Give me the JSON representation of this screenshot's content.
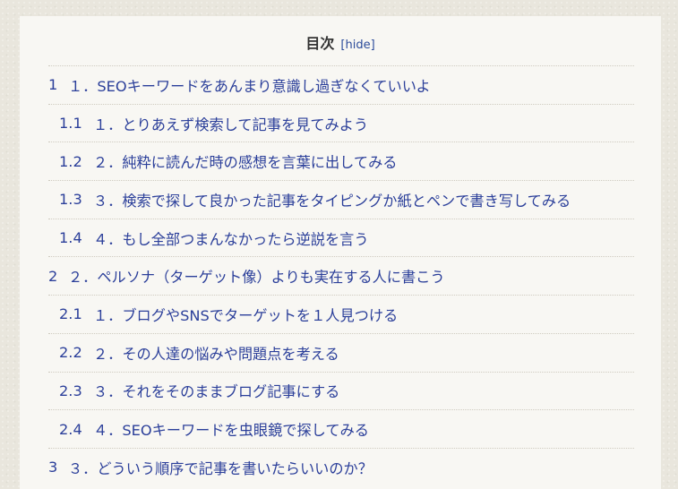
{
  "toc": {
    "title": "目次",
    "toggle_open": "[",
    "toggle_label": "hide",
    "toggle_close": "]",
    "items": [
      {
        "num": "1",
        "text": "１．SEOキーワードをあんまり意識し過ぎなくていいよ",
        "level": 1
      },
      {
        "num": "1.1",
        "text": "１．とりあえず検索して記事を見てみよう",
        "level": 2
      },
      {
        "num": "1.2",
        "text": "２．純粋に読んだ時の感想を言葉に出してみる",
        "level": 2
      },
      {
        "num": "1.3",
        "text": "３．検索で探して良かった記事をタイピングか紙とペンで書き写してみる",
        "level": 2
      },
      {
        "num": "1.4",
        "text": "４．もし全部つまんなかったら逆説を言う",
        "level": 2
      },
      {
        "num": "2",
        "text": "２．ペルソナ（ターゲット像）よりも実在する人に書こう",
        "level": 1
      },
      {
        "num": "2.1",
        "text": "１．ブログやSNSでターゲットを１人見つける",
        "level": 2
      },
      {
        "num": "2.2",
        "text": "２．その人達の悩みや問題点を考える",
        "level": 2
      },
      {
        "num": "2.3",
        "text": "３．それをそのままブログ記事にする",
        "level": 2
      },
      {
        "num": "2.4",
        "text": "４．SEOキーワードを虫眼鏡で探してみる",
        "level": 2
      },
      {
        "num": "3",
        "text": "３．どういう順序で記事を書いたらいいのか？",
        "level": 1
      }
    ]
  },
  "colors": {
    "link": "#2b3f9a",
    "title": "#333333",
    "box_background": "#f8f7f3",
    "page_background": "#e9e6dd"
  }
}
